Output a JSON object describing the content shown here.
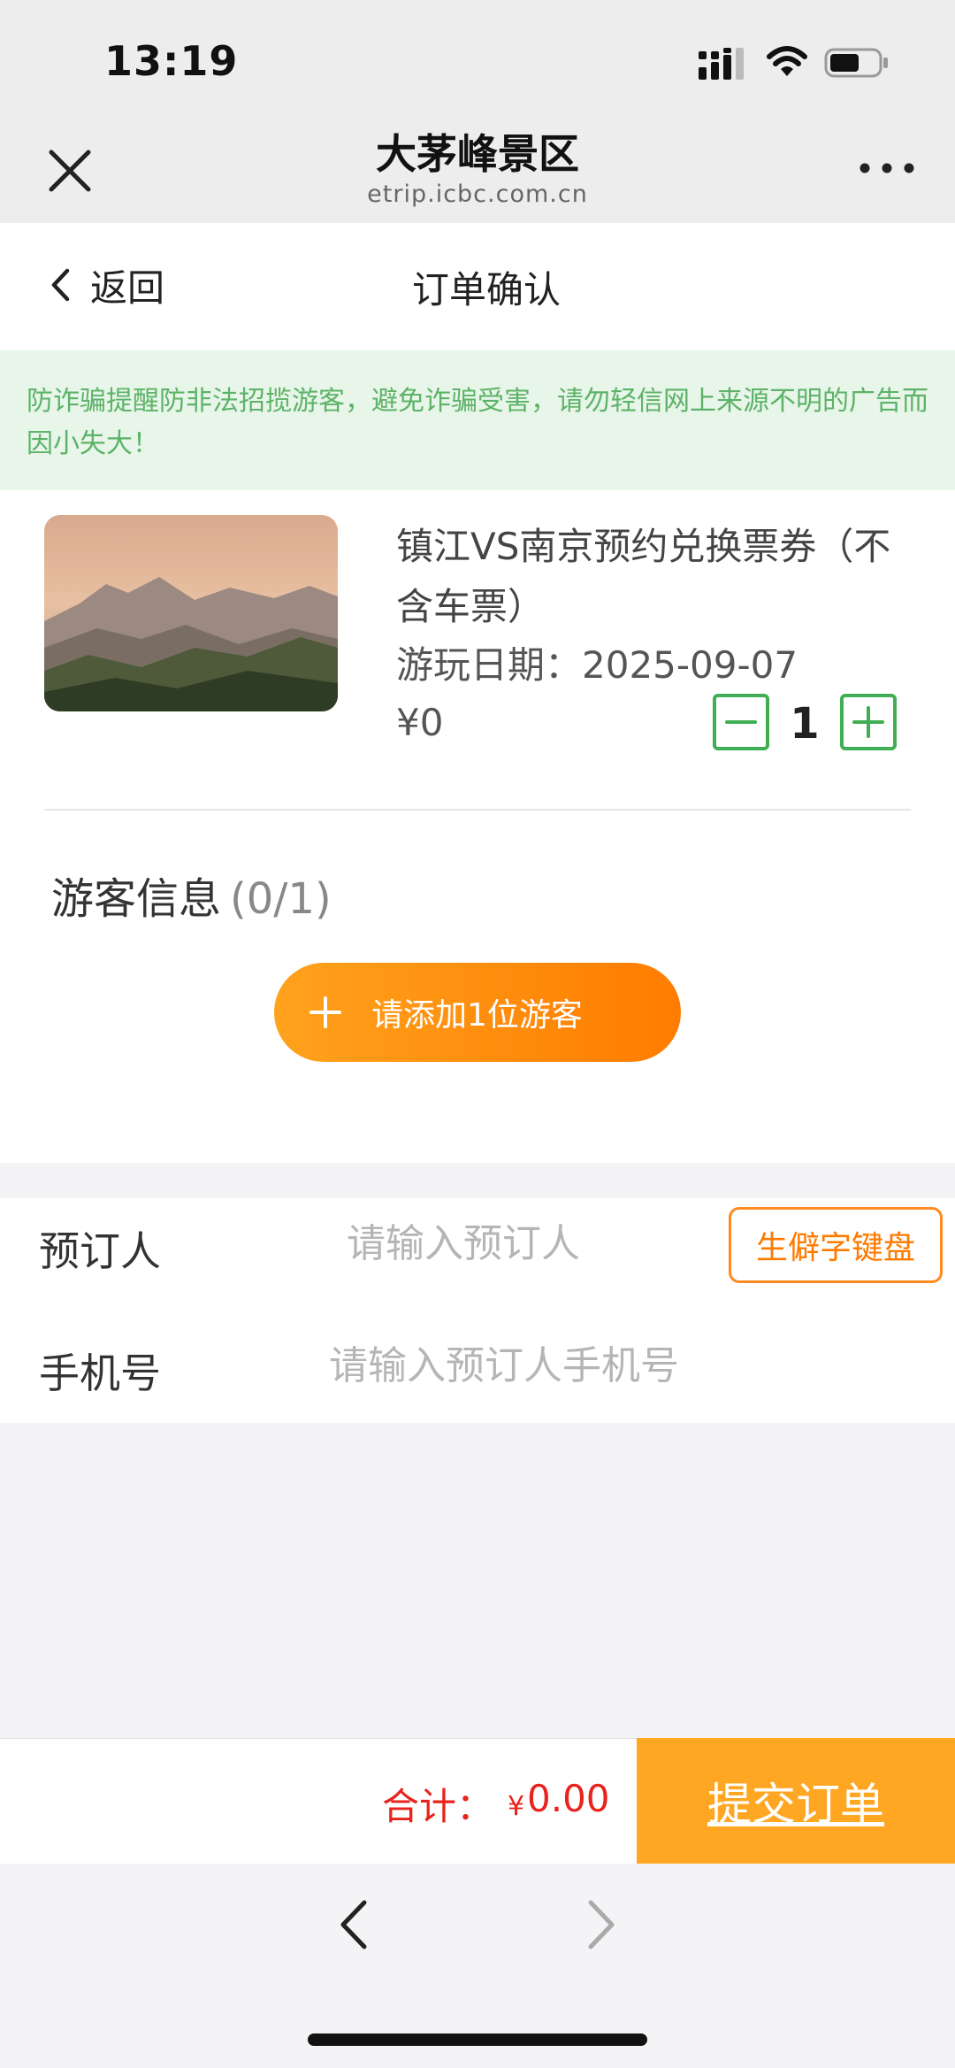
{
  "status_bar": {
    "time": "13:19"
  },
  "webview": {
    "title": "大茅峰景区",
    "domain": "etrip.icbc.com.cn"
  },
  "page_header": {
    "back_label": "返回",
    "title": "订单确认"
  },
  "notice": {
    "text": "防诈骗提醒防非法招揽游客，避免诈骗受害，请勿轻信网上来源不明的广告而因小失大！"
  },
  "product": {
    "name": "镇江VS南京预约兑换票券（不含车票）",
    "play_date": "游玩日期：2025-09-07",
    "price": "¥0",
    "quantity": "1"
  },
  "visitor": {
    "title": "游客信息",
    "count": "(0/1)",
    "add_label": "请添加1位游客"
  },
  "form": {
    "booker_label": "预订人",
    "booker_placeholder": "请输入预订人",
    "rare_keyboard_label": "生僻字键盘",
    "phone_label": "手机号",
    "phone_placeholder": "请输入预订人手机号"
  },
  "footer": {
    "total_label": "合计：",
    "currency": "¥",
    "total_value": "0.00",
    "submit_label": "提交订单"
  },
  "colors": {
    "accent_orange": "#ffa722",
    "green": "#3fae55",
    "notice_bg": "#e8f5e9",
    "total_red": "#e8231b"
  }
}
